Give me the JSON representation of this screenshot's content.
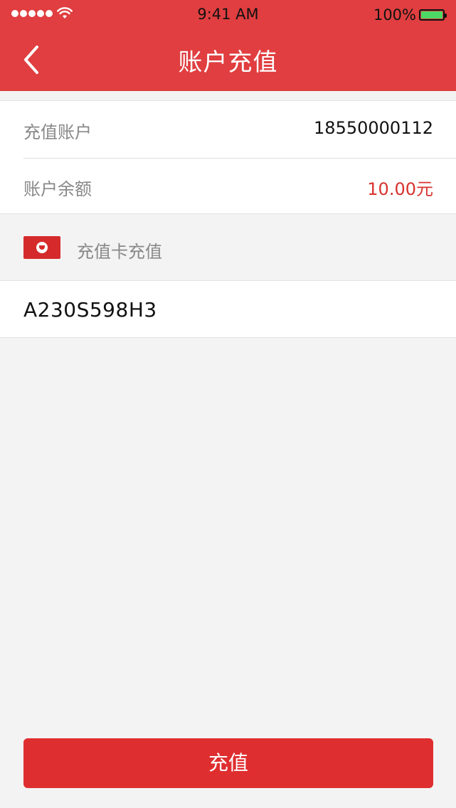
{
  "status_bar": {
    "time": "9:41 AM",
    "battery": "100%",
    "battery_level": 1.0
  },
  "nav": {
    "title": "账户充值",
    "back_icon": "chevron-left-icon"
  },
  "account": {
    "account_label": "充值账户",
    "account_value": "18550000112",
    "balance_label": "账户余额",
    "balance_value": "10.00元"
  },
  "recharge_card": {
    "icon": "recharge-card-icon",
    "label": "充值卡充值",
    "code_value": "A230S598H3"
  },
  "actions": {
    "submit_label": "充值"
  },
  "colors": {
    "brand_red": "#e03e40",
    "button_red": "#df2e2f",
    "amount_red": "#d8322f",
    "background": "#f3f3f3"
  }
}
